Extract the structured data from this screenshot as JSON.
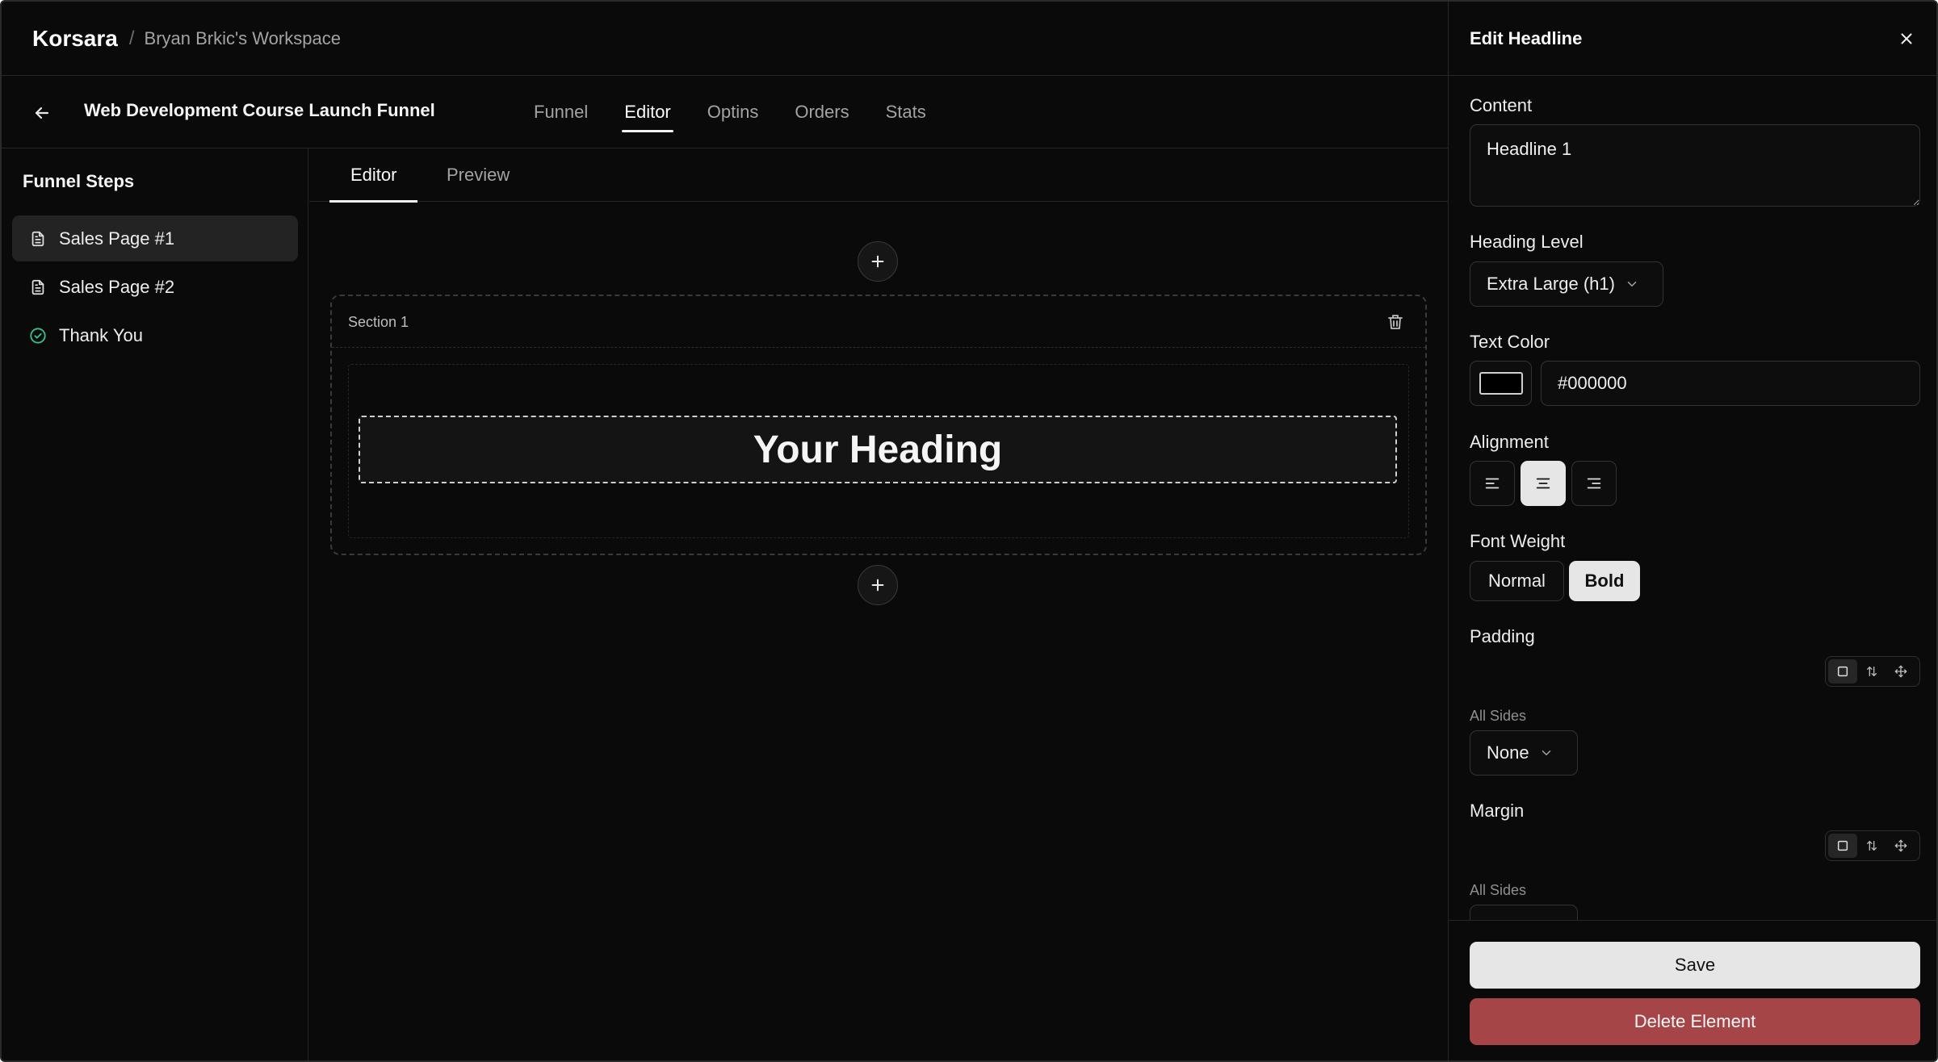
{
  "header": {
    "brand": "Korsara",
    "separator": "/",
    "workspace": "Bryan Brkic's Workspace"
  },
  "funnel": {
    "title": "Web Development Course Launch Funnel",
    "tabs": [
      {
        "label": "Funnel",
        "active": false
      },
      {
        "label": "Editor",
        "active": true
      },
      {
        "label": "Optins",
        "active": false
      },
      {
        "label": "Orders",
        "active": false
      },
      {
        "label": "Stats",
        "active": false
      }
    ]
  },
  "steps": {
    "title": "Funnel Steps",
    "items": [
      {
        "label": "Sales Page #1",
        "icon": "document-icon",
        "active": true
      },
      {
        "label": "Sales Page #2",
        "icon": "document-icon",
        "active": false
      },
      {
        "label": "Thank You",
        "icon": "check-circle-icon",
        "active": false
      }
    ]
  },
  "canvas": {
    "tabs": [
      {
        "label": "Editor",
        "active": true
      },
      {
        "label": "Preview",
        "active": false
      }
    ],
    "section_label": "Section 1",
    "heading_text": "Your Heading"
  },
  "panel": {
    "title": "Edit Headline",
    "content_label": "Content",
    "content_value": "Headline 1",
    "heading_level_label": "Heading Level",
    "heading_level_value": "Extra Large (h1)",
    "text_color_label": "Text Color",
    "text_color_value": "#000000",
    "alignment_label": "Alignment",
    "alignment_options": [
      "left",
      "center",
      "right"
    ],
    "alignment_selected": "center",
    "font_weight_label": "Font Weight",
    "font_weight_options": [
      "Normal",
      "Bold"
    ],
    "font_weight_selected": "Bold",
    "padding_label": "Padding",
    "padding_sides_label": "All Sides",
    "padding_value": "None",
    "margin_label": "Margin",
    "margin_sides_label": "All Sides",
    "save_label": "Save",
    "delete_label": "Delete Element"
  },
  "colors": {
    "background": "#0a0a0a",
    "accent": "#e6e6e6",
    "danger": "#a54548",
    "success": "#34c38f",
    "text_color_swatch": "#000000"
  }
}
